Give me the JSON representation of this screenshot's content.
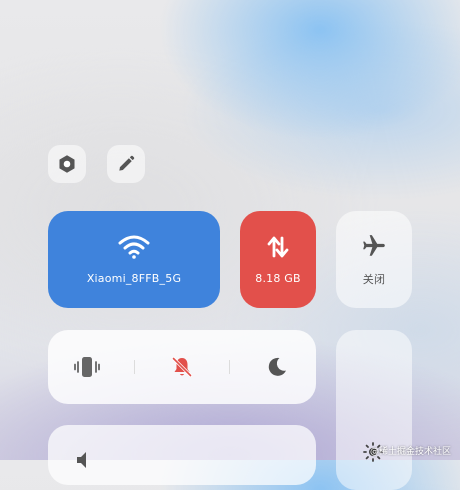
{
  "toolbar": {
    "settings_icon": "hexagon-settings-icon",
    "edit_icon": "pencil-edit-icon"
  },
  "wifi": {
    "label": "Xiaomi_8FFB_5G",
    "icon": "wifi-icon",
    "color": "#3f83dc"
  },
  "mobile_data": {
    "label": "8.18 GB",
    "icon": "data-transfer-arrows-icon",
    "color": "#e2504b"
  },
  "airplane": {
    "label": "关闭",
    "icon": "airplane-icon"
  },
  "modes": {
    "items": [
      {
        "name": "vibrate",
        "icon": "vibrate-icon"
      },
      {
        "name": "silent",
        "icon": "bell-off-icon",
        "color": "#e2504b"
      },
      {
        "name": "do-not-disturb",
        "icon": "moon-icon"
      }
    ]
  },
  "watermark": {
    "text": "@稀土掘金技术社区"
  }
}
